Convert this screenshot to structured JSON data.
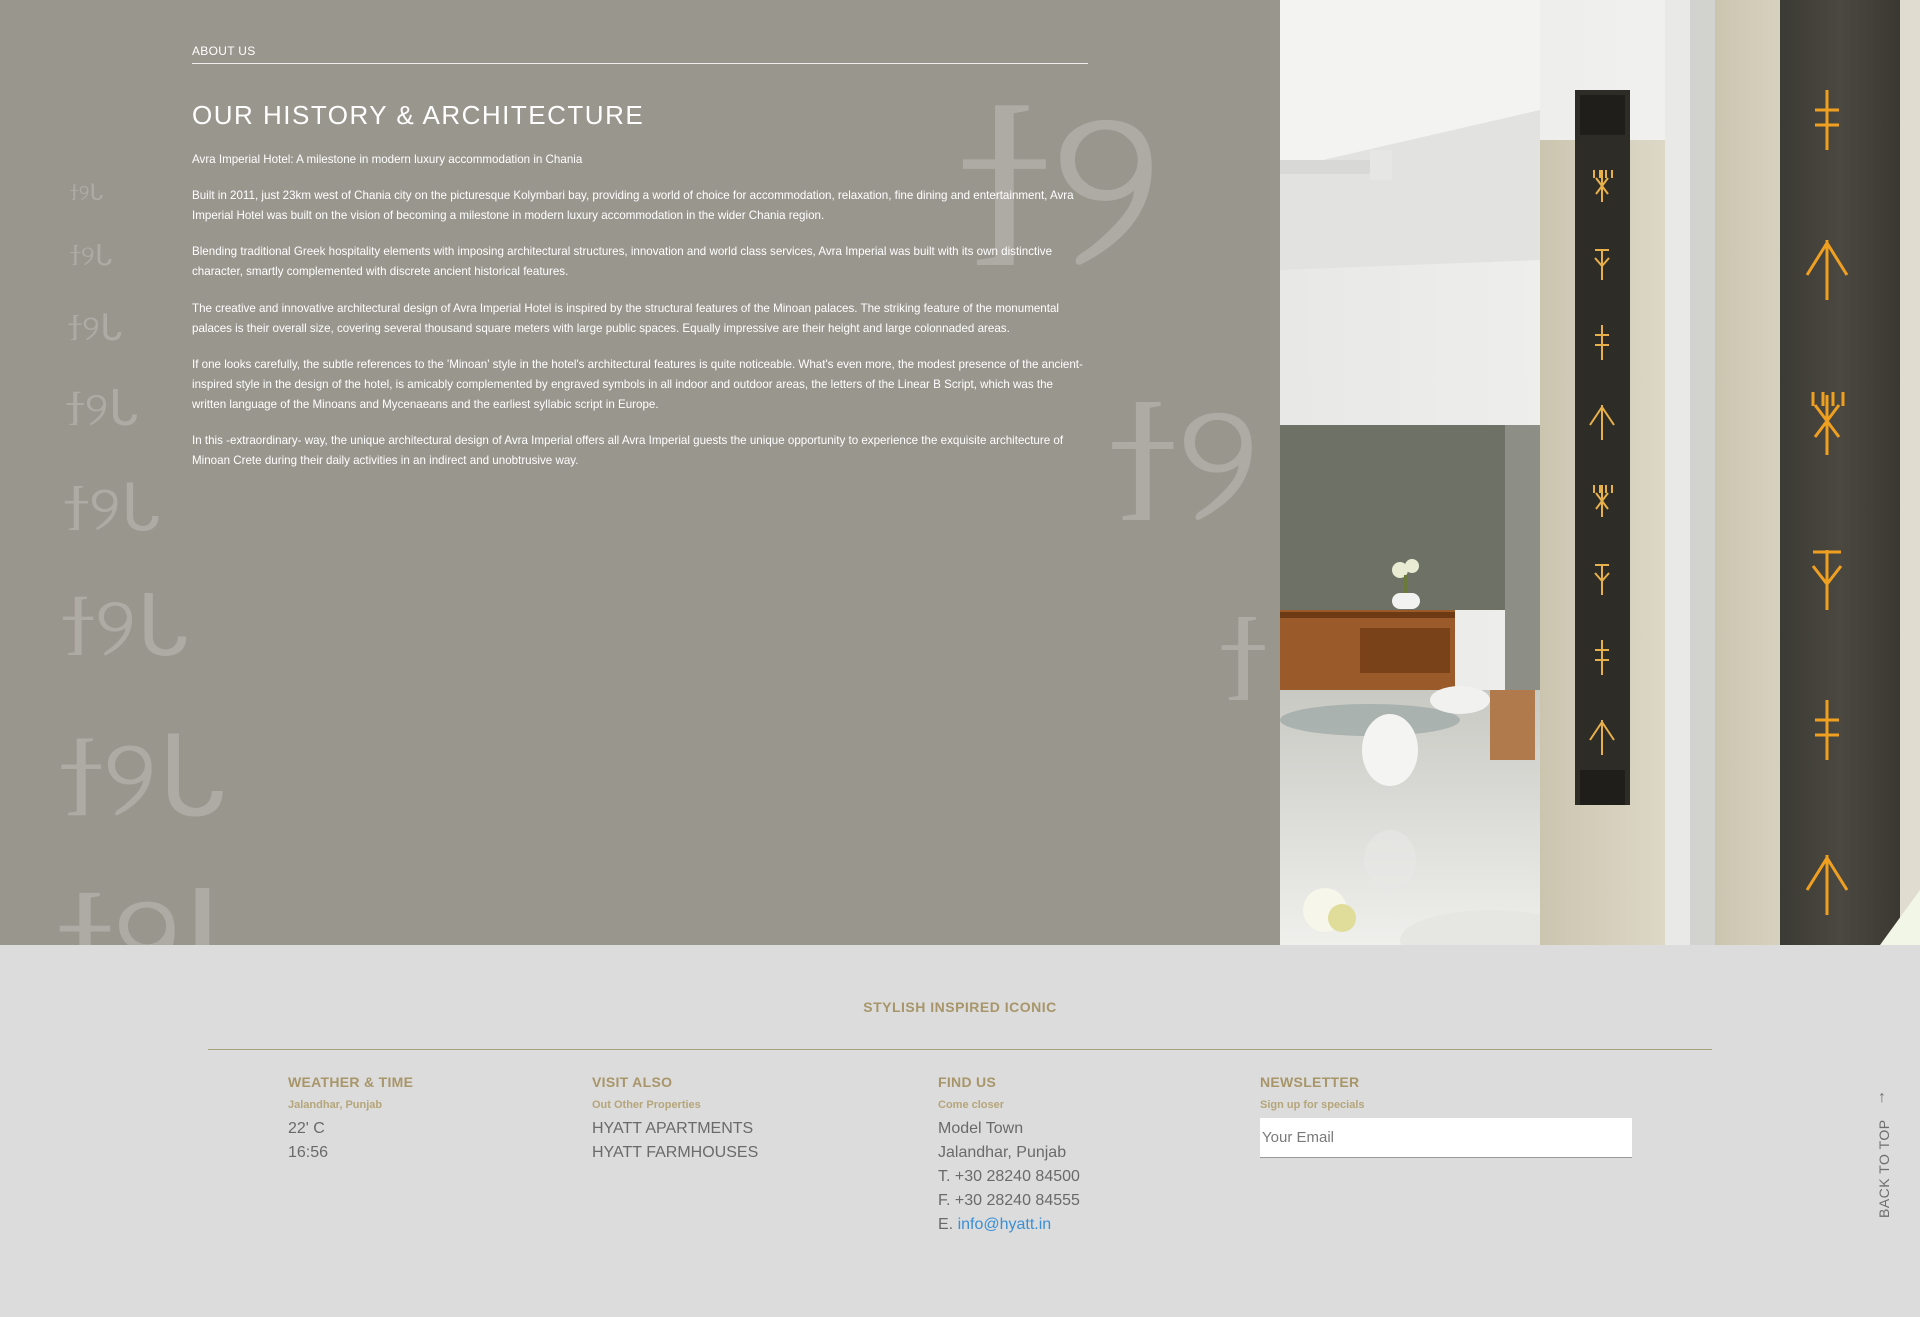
{
  "about": {
    "eyebrow": "ABOUT US",
    "title": "OUR HISTORY & ARCHITECTURE",
    "paragraphs": [
      "Avra Imperial Hotel: A milestone in modern luxury accommodation in Chania",
      "Built in 2011, just 23km west of Chania city on the picturesque Kolymbari bay, providing a world of choice for accommodation, relaxation, fine dining and entertainment, Avra Imperial Hotel was built on the vision of becoming a milestone in modern luxury accommodation in the wider Chania region.",
      "Blending traditional Greek hospitality elements with imposing architectural structures, innovation and world class services, Avra Imperial was built with its own distinctive character, smartly complemented with discrete ancient historical features.",
      "The creative and innovative architectural design of Avra Imperial Hotel is inspired by the structural features of the Minoan palaces. The striking feature of the monumental palaces is their overall size, covering several thousand square meters with large public spaces. Equally impressive are their height and large colonnaded areas.",
      "If one looks carefully, the subtle references to the 'Minoan' style in the hotel's architectural features is quite noticeable. What's even more, the modest presence of the ancient-inspired style in the design of the hotel, is amicably complemented by engraved symbols in all indoor and outdoor areas, the letters of the Linear B Script, which was the written language of the Minoans and Mycenaeans and the earliest syllabic script in Europe.",
      "In this -extraordinary- way, the unique architectural design of Avra Imperial offers all Avra Imperial guests the unique opportunity to experience the exquisite architecture of Minoan Crete during their daily activities in an indirect and unobtrusive way."
    ]
  },
  "footer": {
    "tagline": "STYLISH INSPIRED ICONIC",
    "weather": {
      "heading": "WEATHER & TIME",
      "location": "Jalandhar, Punjab",
      "temperature": "22' C",
      "time": "16:56"
    },
    "visit": {
      "heading": "VISIT ALSO",
      "subheading": "Out Other Properties",
      "links": [
        "HYATT APARTMENTS",
        "HYATT FARMHOUSES"
      ]
    },
    "find": {
      "heading": "FIND US",
      "subheading": "Come closer",
      "address_line1": "Model Town",
      "address_line2": "Jalandhar, Punjab",
      "phone": "T. +30 28240 84500",
      "fax": "F. +30 28240 84555",
      "email_prefix": "E.",
      "email": "info@hyatt.in"
    },
    "newsletter": {
      "heading": "NEWSLETTER",
      "subheading": "Sign up for specials",
      "placeholder": "Your Email"
    },
    "back_to_top": "BACK TO TOP"
  },
  "colors": {
    "top_bg": "#99968e",
    "footer_bg": "#dcdcdc",
    "accent_gold": "#a8966a",
    "link_blue": "#3b8fd6"
  },
  "icons": [
    "linear-b-watermark",
    "arrow-up-icon"
  ]
}
